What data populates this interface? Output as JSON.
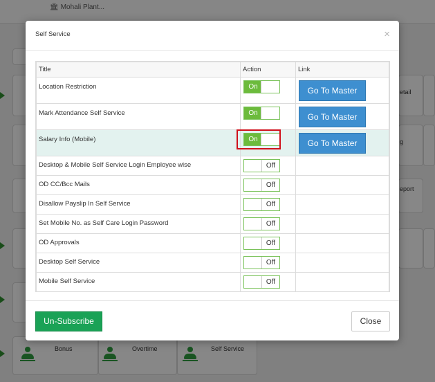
{
  "background": {
    "breadcrumb": "Mohali Plant...",
    "partial_labels": [
      "etail",
      "g",
      "eport"
    ],
    "bottom_tiles": [
      "Bonus",
      "Overtime",
      "Self Service"
    ]
  },
  "modal": {
    "title": "Self Service",
    "close_glyph": "×",
    "columns": [
      "Title",
      "Action",
      "Link"
    ],
    "rows": [
      {
        "title": "Location Restriction",
        "state": "On",
        "link": "Go To Master"
      },
      {
        "title": "Mark Attendance Self Service",
        "state": "On",
        "link": "Go To Master"
      },
      {
        "title": "Salary Info (Mobile)",
        "state": "On",
        "link": "Go To Master",
        "highlighted": true
      },
      {
        "title": "Desktop & Mobile Self Service Login Employee wise",
        "state": "Off",
        "link": ""
      },
      {
        "title": "OD CC/Bcc Mails",
        "state": "Off",
        "link": ""
      },
      {
        "title": "Disallow Payslip In Self Service",
        "state": "Off",
        "link": ""
      },
      {
        "title": "Set Mobile No. as Self Care Login Password",
        "state": "Off",
        "link": ""
      },
      {
        "title": "OD Approvals",
        "state": "Off",
        "link": ""
      },
      {
        "title": "Desktop Self Service",
        "state": "Off",
        "link": ""
      },
      {
        "title": "Mobile Self Service",
        "state": "Off",
        "link": ""
      }
    ],
    "footer": {
      "unsubscribe_label": "Un-Subscribe",
      "close_label": "Close"
    }
  },
  "colors": {
    "toggle_on": "#6cbb3c",
    "link_button": "#3e8fd0",
    "unsubscribe_button": "#1aa256",
    "highlight_row": "#e3f2ef",
    "red_outline": "#d0101a"
  }
}
